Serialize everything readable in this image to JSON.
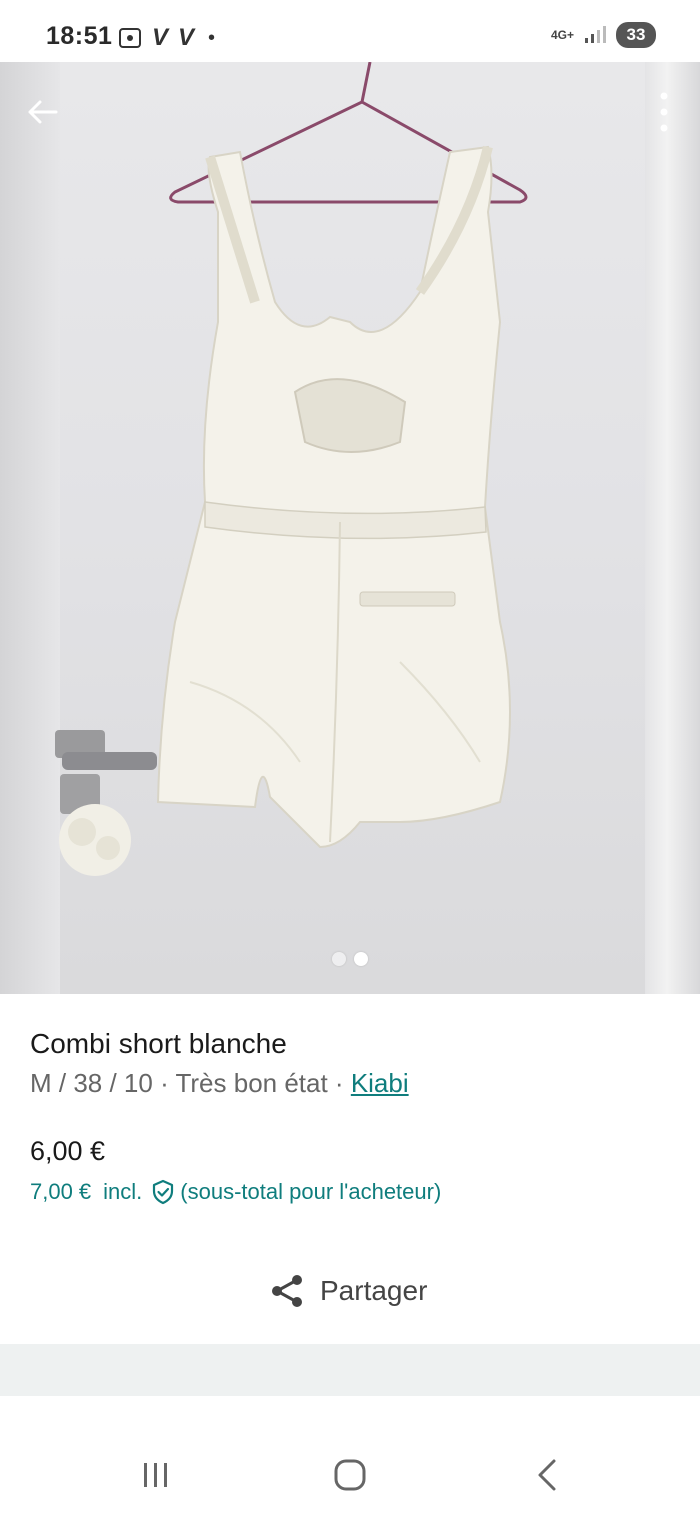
{
  "status_bar": {
    "time": "18:51",
    "left_icons": [
      "screenshot-icon",
      "v-app-icon",
      "v-app-icon"
    ],
    "network": "4G+",
    "battery": "33"
  },
  "photo": {
    "description_icon": "product-photo",
    "page_count": 2,
    "active_page": 2
  },
  "product": {
    "title": "Combi short blanche",
    "details": "M / 38 / 10 · Très bon état · ",
    "brand": "Kiabi",
    "price": "6,00 €",
    "price_incl_amount": "7,00 €",
    "price_incl_label": "incl.",
    "price_incl_note": "(sous-total pour l'acheteur)"
  },
  "actions": {
    "share_label": "Partager"
  },
  "colors": {
    "accent": "#0f7d7d",
    "band": "#eef1f1"
  }
}
